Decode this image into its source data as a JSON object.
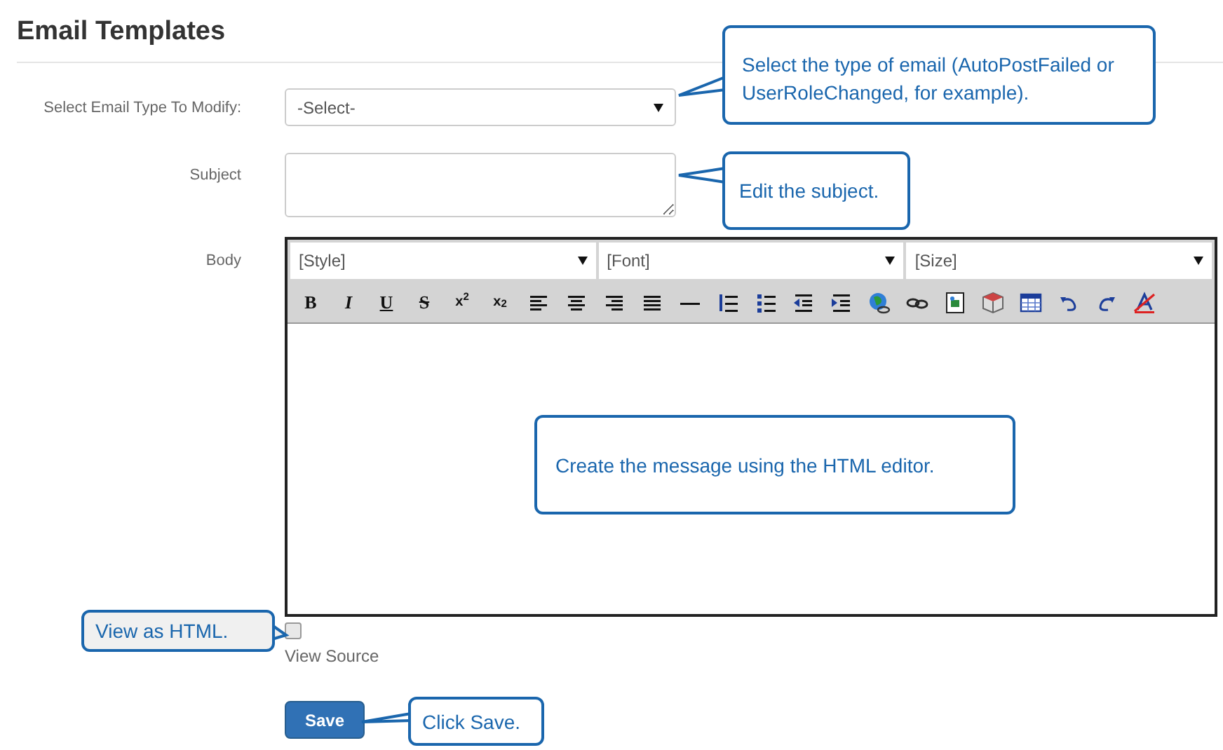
{
  "page_title": "Email Templates",
  "email_type": {
    "label": "Select Email Type To Modify:",
    "value": "-Select-"
  },
  "subject": {
    "label": "Subject"
  },
  "body": {
    "label": "Body",
    "dropdowns": [
      {
        "value": "[Style]"
      },
      {
        "value": "[Font]"
      },
      {
        "value": "[Size]"
      }
    ],
    "toolbar": [
      {
        "kind": "bold",
        "label": "B"
      },
      {
        "kind": "italic",
        "label": "I"
      },
      {
        "kind": "underline",
        "label": "U"
      },
      {
        "kind": "strike",
        "label": "S"
      },
      {
        "kind": "script",
        "label": "x$^{2}$"
      },
      {
        "kind": "script",
        "label": "x$_{2}$"
      },
      {
        "kind": "align-left"
      },
      {
        "kind": "align-center"
      },
      {
        "kind": "align-right"
      },
      {
        "kind": "justify"
      },
      {
        "kind": "rule"
      },
      {
        "kind": "ordered-list"
      },
      {
        "kind": "bullet-list"
      },
      {
        "kind": "outdent"
      },
      {
        "kind": "indent"
      },
      {
        "kind": "globe"
      },
      {
        "kind": "link"
      },
      {
        "kind": "image"
      },
      {
        "kind": "cube"
      },
      {
        "kind": "table"
      },
      {
        "kind": "undo"
      },
      {
        "kind": "redo"
      },
      {
        "kind": "clear-format"
      }
    ]
  },
  "view_source": {
    "label": "View Source",
    "checked": false
  },
  "save_button": "Save",
  "callouts": [
    {
      "text": "Select the type of email (AutoPostFailed or UserRoleChanged, for example).",
      "shaded": false
    },
    {
      "text": "Edit the subject.",
      "shaded": false
    },
    {
      "text": "Create the message using the HTML editor.",
      "shaded": false
    },
    {
      "text": "View as HTML.",
      "shaded": true
    },
    {
      "text": "Click Save.",
      "shaded": false
    }
  ]
}
